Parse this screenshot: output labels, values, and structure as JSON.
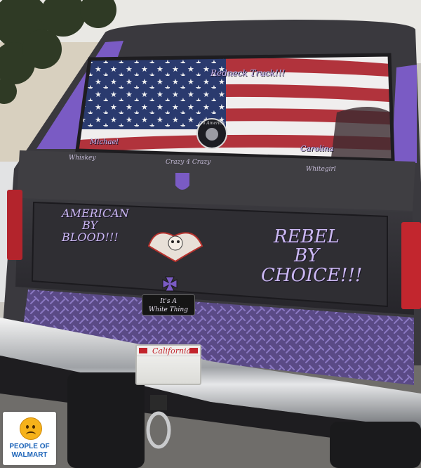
{
  "window_text": {
    "top_right": "Redneck Truck!!!",
    "left_name": "Michael",
    "right_name": "Carolina",
    "emblem": "Go Americans"
  },
  "tailgate_labels": {
    "left": "Whiskey",
    "center": "Crazy 4 Crazy",
    "right": "Whitegirl"
  },
  "tailgate_paint": {
    "left_lines": [
      "AMERICAN",
      "BY",
      "BLOOD!!!"
    ],
    "right_lines": [
      "REBEL",
      "BY",
      "CHOICE!!!"
    ]
  },
  "bumper_sticker": {
    "lines": [
      "It's A",
      "White Thing"
    ]
  },
  "license_plate": {
    "state": "California"
  },
  "watermark": {
    "line1": "PEOPLE OF",
    "line2": "WALMART"
  },
  "colors": {
    "truck": "#2c2b2f",
    "purple_trim": "#7a5bc4",
    "flag_red": "#b1333c",
    "flag_blue": "#2a3a6e",
    "lettering": "#cbb8f2",
    "watermark_blue": "#1b63b8"
  }
}
